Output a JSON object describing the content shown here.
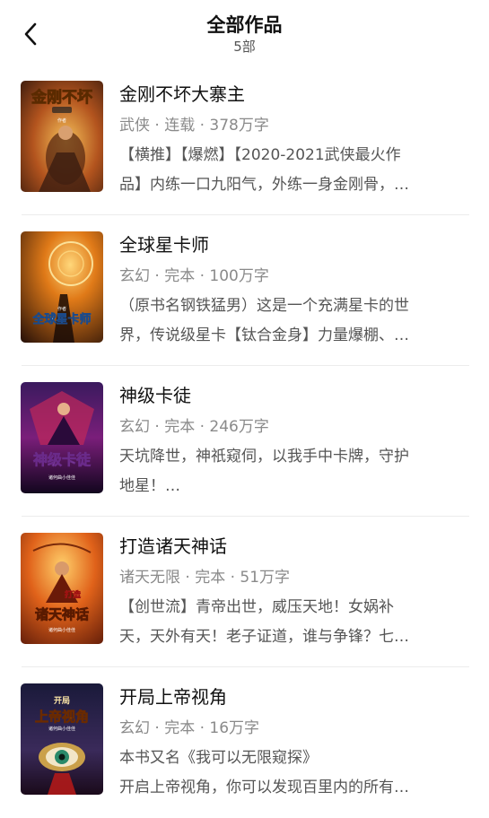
{
  "header": {
    "title": "全部作品",
    "count": "5部"
  },
  "books": [
    {
      "title": "金刚不坏大寨主",
      "meta": "武侠 · 连载 · 378万字",
      "desc1": "【横推】【爆燃】【2020-2021武侠最火作",
      "desc2": "品】内练一口九阳气，外练一身金刚骨，…",
      "cover_text": "金刚不坏",
      "cover_author": "作者"
    },
    {
      "title": "全球星卡师",
      "meta": "玄幻 · 完本 · 100万字",
      "desc1": "（原书名钢铁猛男）这是一个充满星卡的世",
      "desc2": "界，传说级星卡【钛合金身】力量爆棚、…",
      "cover_text": "全球星卡师",
      "cover_author": "作者"
    },
    {
      "title": "神级卡徒",
      "meta": "玄幻 · 完本 · 246万字",
      "desc1": "天坑降世，神祇窥伺，以我手中卡牌，守护",
      "desc2": "地星！…",
      "cover_text": "神级卡徒",
      "cover_author": "诸何曲小佳佳"
    },
    {
      "title": "打造诸天神话",
      "meta": "诸天无限 · 完本 · 51万字",
      "desc1": "【创世流】青帝出世，威压天地！女娲补",
      "desc2": "天，天外有天！老子证道，谁与争锋？七…",
      "cover_text": "诸天神话",
      "cover_top": "打造",
      "cover_author": "诸何曲小佳佳"
    },
    {
      "title": "开局上帝视角",
      "meta": "玄幻 · 完本 · 16万字",
      "desc1": "本书又名《我可以无限窥探》",
      "desc2": "开启上帝视角，你可以发现百里内的所有…",
      "cover_text": "上帝视角",
      "cover_top": "开局",
      "cover_author": "诸何曲小佳佳"
    }
  ]
}
